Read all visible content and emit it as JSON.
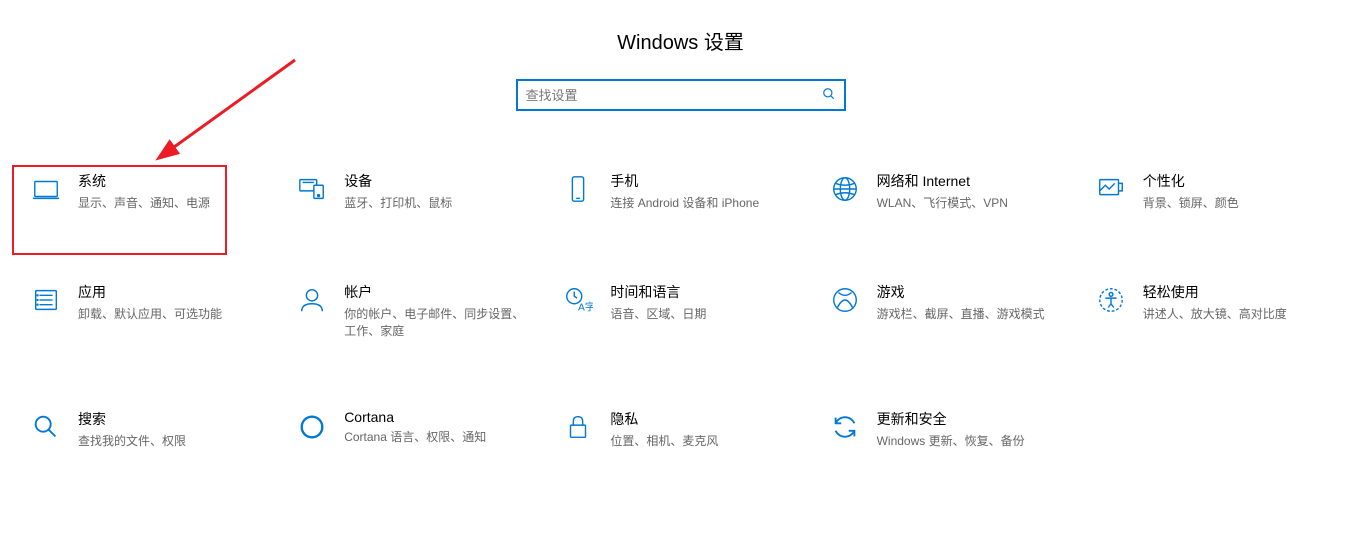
{
  "title": "Windows 设置",
  "search": {
    "placeholder": "查找设置"
  },
  "tiles": [
    {
      "title": "系统",
      "desc": "显示、声音、通知、电源"
    },
    {
      "title": "设备",
      "desc": "蓝牙、打印机、鼠标"
    },
    {
      "title": "手机",
      "desc": "连接 Android 设备和 iPhone"
    },
    {
      "title": "网络和 Internet",
      "desc": "WLAN、飞行模式、VPN"
    },
    {
      "title": "个性化",
      "desc": "背景、锁屏、颜色"
    },
    {
      "title": "应用",
      "desc": "卸载、默认应用、可选功能"
    },
    {
      "title": "帐户",
      "desc": "你的帐户、电子邮件、同步设置、工作、家庭"
    },
    {
      "title": "时间和语言",
      "desc": "语音、区域、日期"
    },
    {
      "title": "游戏",
      "desc": "游戏栏、截屏、直播、游戏模式"
    },
    {
      "title": "轻松使用",
      "desc": "讲述人、放大镜、高对比度"
    },
    {
      "title": "搜索",
      "desc": "查找我的文件、权限"
    },
    {
      "title": "Cortana",
      "desc": "Cortana 语言、权限、通知"
    },
    {
      "title": "隐私",
      "desc": "位置、相机、麦克风"
    },
    {
      "title": "更新和安全",
      "desc": "Windows 更新、恢复、备份"
    }
  ]
}
